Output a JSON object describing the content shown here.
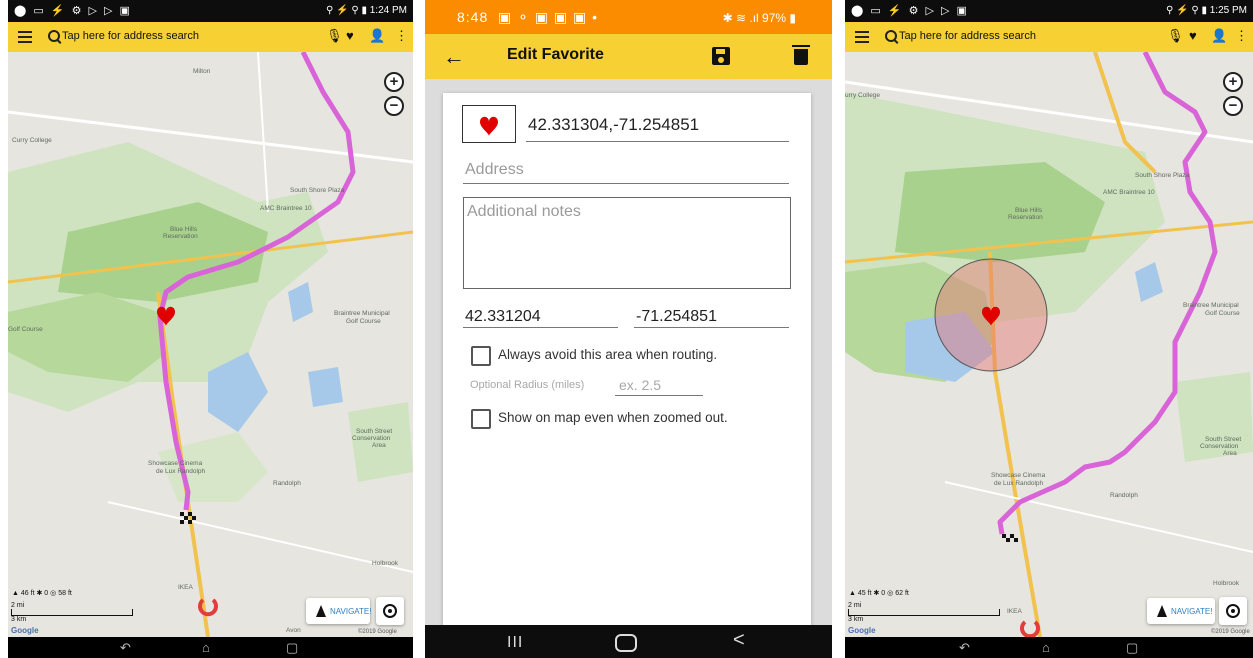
{
  "left_screen": {
    "status": {
      "icons": "⬤ ▭ ⚡ ⚙ ▷ ▷ ▣",
      "right": "⚲ ⚡ ⚲ ▮ 1:24 PM"
    },
    "search_placeholder": "Tap here for address search",
    "map_labels": {
      "milton": "Milton",
      "curry_college": "Curry College",
      "south_shore_plaza": "South Shore Plaza",
      "amc": "AMC Braintree 10",
      "blue_hills": "Blue Hills",
      "reservation": "Reservation",
      "braintree_muni": "Braintree Municipal",
      "golf_course_r": "Golf Course",
      "golf_course_l": "Golf Course",
      "south_street": "South Street",
      "conservation": "Conservation",
      "area": "Area",
      "showcase": "Showcase Cinema",
      "de_lux": "de Lux Randolph",
      "randolph": "Randolph",
      "holbrook": "Holbrook",
      "ikea": "IKEA",
      "avon": "Avon"
    },
    "stats": {
      "elevation": "46 ft",
      "bikes": "0",
      "target": "58 ft"
    },
    "scale": {
      "miles": "2 mi",
      "km": "3 km"
    },
    "google": "Google",
    "copyright": "©2019 Google",
    "navigate": "NAVIGATE!"
  },
  "editor": {
    "status_time": "8:48",
    "status_icons": "▣ ⚬ ▣ ▣ ▣ •",
    "status_right": "✱ ≋ .ıl 97% ▮",
    "title": "Edit Favorite",
    "name_value": "42.331304,-71.254851",
    "address_placeholder": "Address",
    "notes_placeholder": "Additional notes",
    "latitude": "42.331204",
    "longitude": "-71.254851",
    "avoid_label": "Always avoid this area when routing.",
    "radius_label": "Optional Radius (miles)",
    "radius_placeholder": "ex. 2.5",
    "show_label": "Show on map even when zoomed out.",
    "nav": {
      "recents": "III",
      "back": "<"
    }
  },
  "right_screen": {
    "status": {
      "icons": "⬤ ▭ ⚡ ⚙ ▷ ▷ ▣",
      "right": "⚲ ⚡ ⚲ ▮ 1:25 PM"
    },
    "search_placeholder": "Tap here for address search",
    "map_labels": {
      "curry_college": "urry College",
      "south_shore_plaza": "South Shore Plaza",
      "amc": "AMC Braintree 10",
      "blue_hills": "Blue Hills",
      "reservation": "Reservation",
      "braintree_muni": "Braintree Municipal",
      "golf_course_r": "Golf Course",
      "south_street": "South Street",
      "conservation": "Conservation",
      "area": "Area",
      "showcase": "Showcase Cinema",
      "de_lux": "de Lux Randolph",
      "randolph": "Randolph",
      "holbrook": "Holbrook",
      "ikea": "IKEA"
    },
    "stats": {
      "elevation": "45 ft",
      "bikes": "0",
      "target": "62 ft"
    },
    "scale": {
      "miles": "2 mi",
      "km": "3 km"
    },
    "google": "Google",
    "copyright": "©2019 Google",
    "navigate": "NAVIGATE!"
  },
  "colors": {
    "accent": "#f7d033",
    "route": "#d864d8",
    "heart": "#e00000",
    "status_orange": "#fb8c00"
  }
}
